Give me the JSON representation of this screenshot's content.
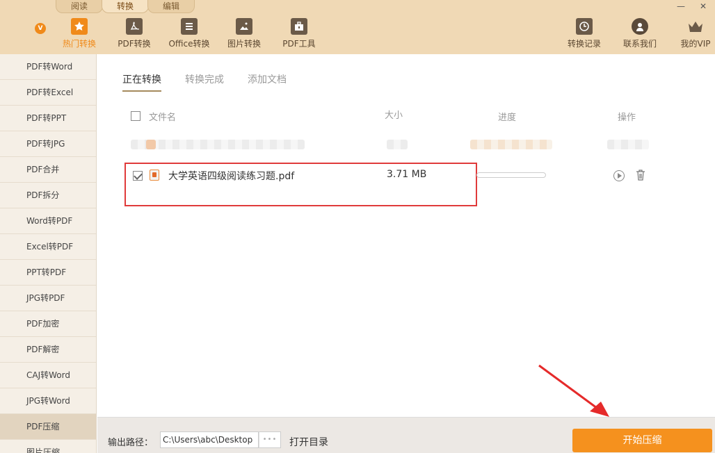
{
  "top_tabs": [
    "阅读",
    "转换",
    "编辑"
  ],
  "window_buttons": [
    "—",
    "✕"
  ],
  "nav": {
    "v_badge": "V",
    "left": [
      {
        "label": "热门转换",
        "icon": "star-icon"
      },
      {
        "label": "PDF转换",
        "icon": "pdf-icon"
      },
      {
        "label": "Office转换",
        "icon": "document-icon"
      },
      {
        "label": "图片转换",
        "icon": "image-icon"
      },
      {
        "label": "PDF工具",
        "icon": "toolbox-icon"
      }
    ],
    "right": [
      {
        "label": "转换记录",
        "icon": "clock-icon"
      },
      {
        "label": "联系我们",
        "icon": "headset-icon"
      },
      {
        "label": "我的VIP",
        "icon": "crown-icon"
      }
    ]
  },
  "sidebar": {
    "items": [
      "PDF转Word",
      "PDF转Excel",
      "PDF转PPT",
      "PDF转JPG",
      "PDF合并",
      "PDF拆分",
      "Word转PDF",
      "Excel转PDF",
      "PPT转PDF",
      "JPG转PDF",
      "PDF加密",
      "PDF解密",
      "CAJ转Word",
      "JPG转Word",
      "PDF压缩",
      "图片压缩"
    ],
    "active": "PDF压缩"
  },
  "content": {
    "tabs": [
      "正在转换",
      "转换完成",
      "添加文档"
    ],
    "columns": {
      "name": "文件名",
      "size": "大小",
      "progress": "进度",
      "action": "操作"
    },
    "file": {
      "name": "大学英语四级阅读练习题.pdf",
      "size": "3.71 MB",
      "progress": 0
    }
  },
  "bottom": {
    "output_label": "输出路径：",
    "output_path": "C:\\Users\\abc\\Desktop",
    "browse": "•••",
    "open_dir": "打开目录",
    "start": "开始压缩"
  },
  "colors": {
    "accent": "#f5911e",
    "header_bg": "#f0d9b5",
    "highlight": "#e03a3a"
  }
}
